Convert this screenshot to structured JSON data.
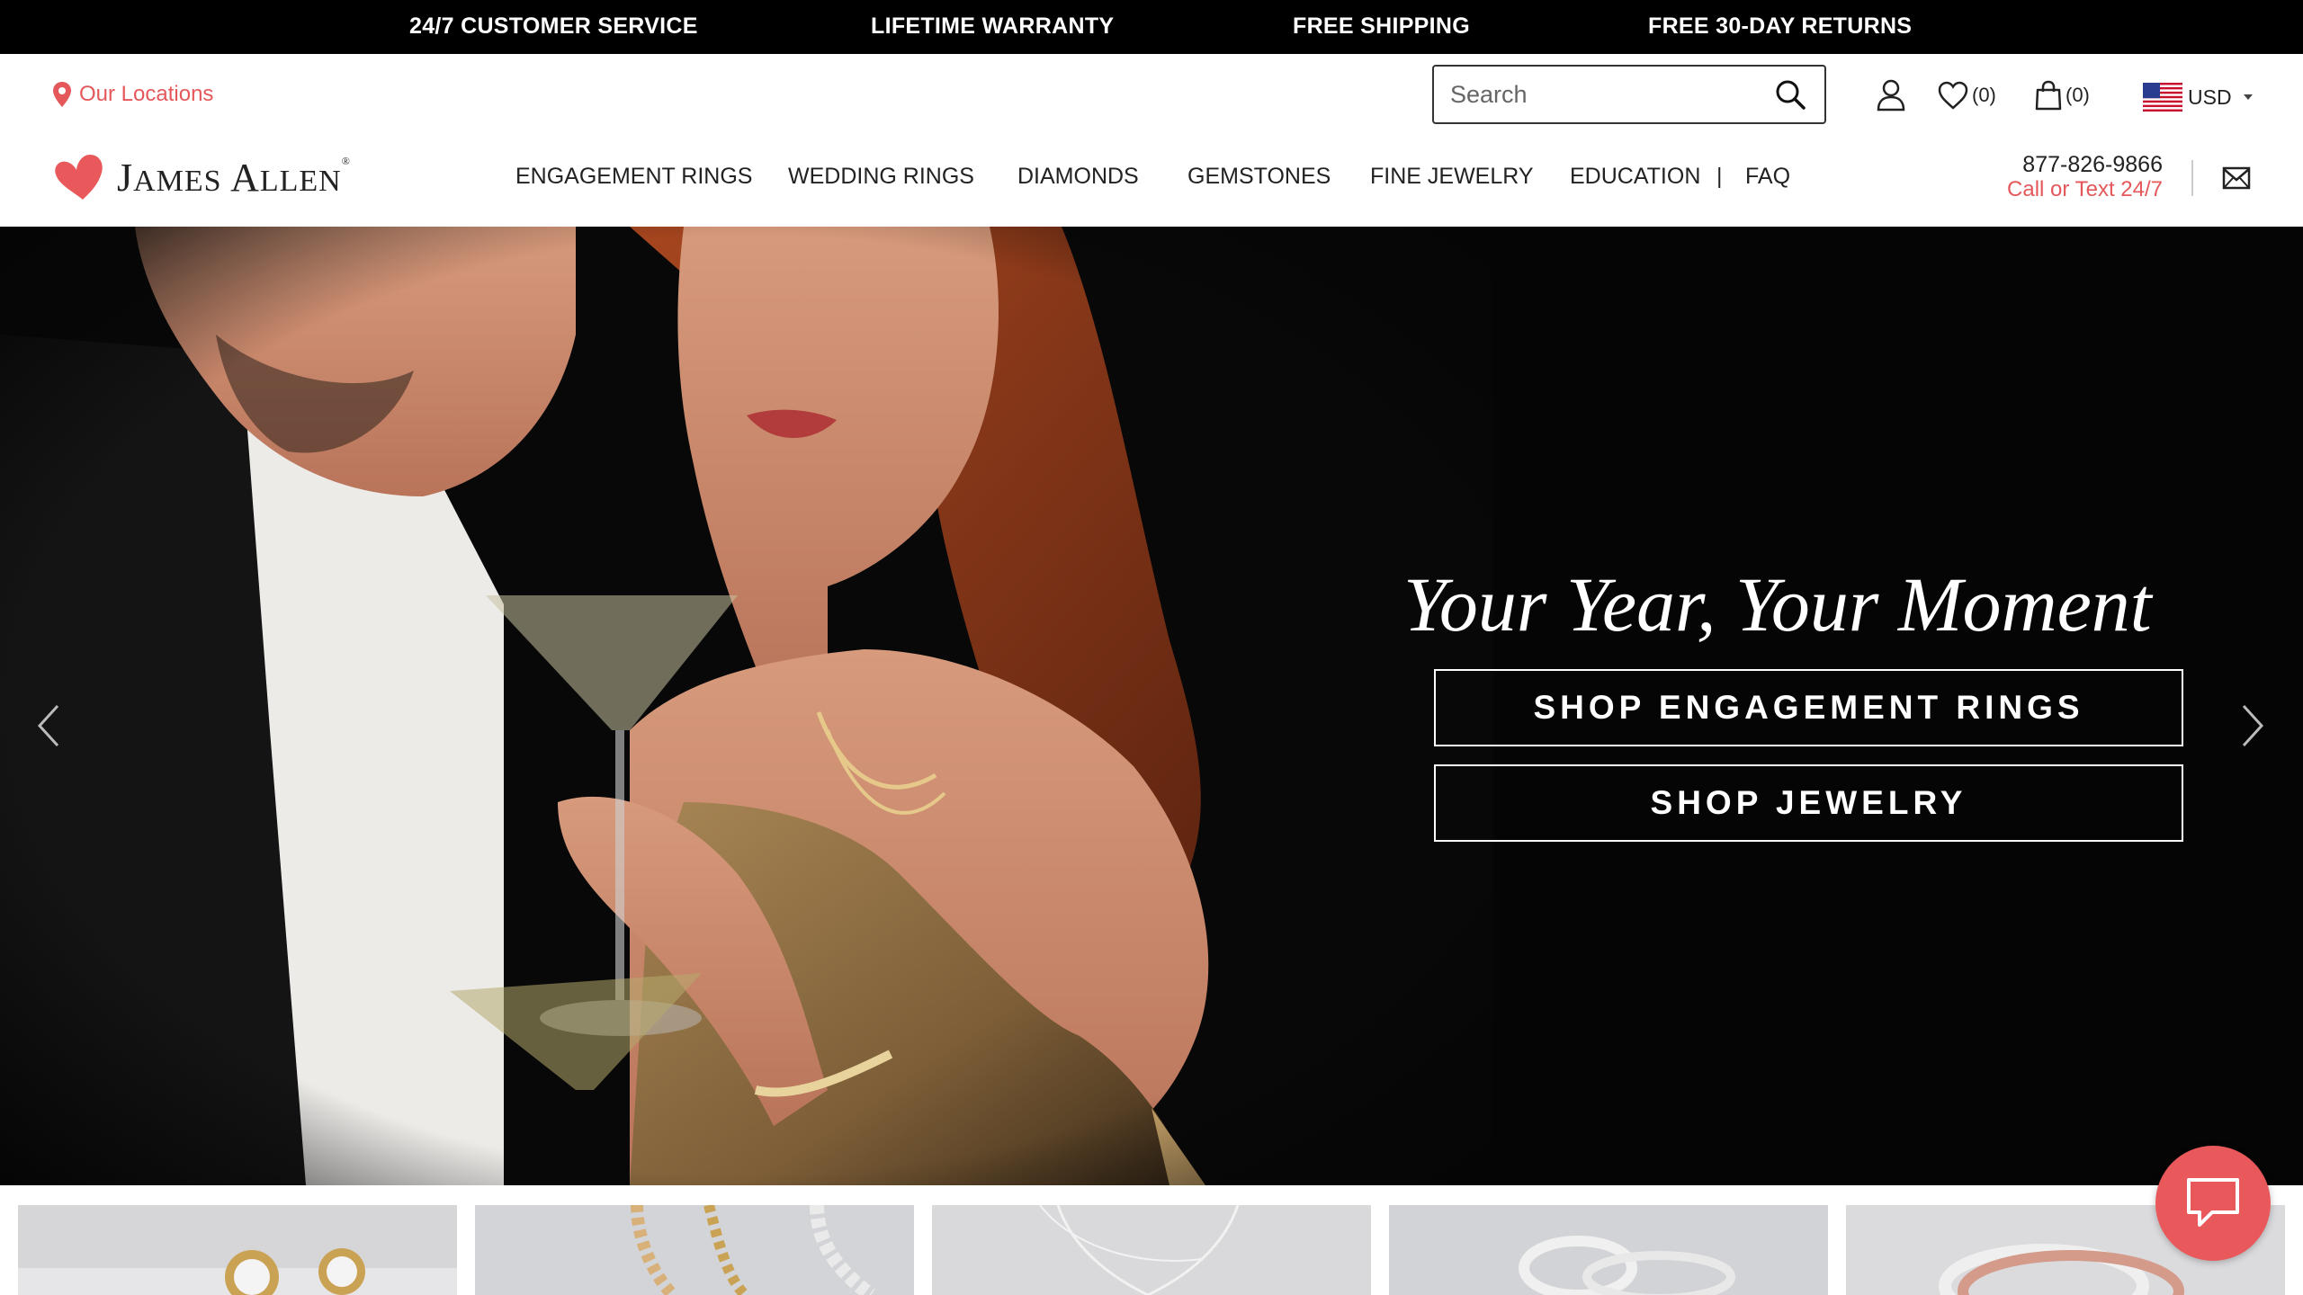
{
  "promo_bar": {
    "items": [
      "24/7 CUSTOMER SERVICE",
      "LIFETIME WARRANTY",
      "FREE SHIPPING",
      "FREE 30-DAY RETURNS"
    ]
  },
  "utility": {
    "locations_label": "Our Locations",
    "search_placeholder": "Search",
    "wishlist_count": "(0)",
    "cart_count": "(0)",
    "currency": "USD"
  },
  "header": {
    "logo_text_first": "J",
    "logo_text_rest_1": "AMES ",
    "logo_text_a": "A",
    "logo_text_rest_2": "LLEN",
    "logo_reg": "®",
    "nav": [
      "ENGAGEMENT RINGS",
      "WEDDING RINGS",
      "DIAMONDS",
      "GEMSTONES",
      "FINE JEWELRY",
      "EDUCATION",
      "FAQ"
    ],
    "nav_separator": "|",
    "phone_number": "877-826-9866",
    "phone_sub": "Call or Text 24/7"
  },
  "hero": {
    "title": "Your Year, Your Moment",
    "buttons": [
      "SHOP ENGAGEMENT RINGS",
      "SHOP JEWELRY"
    ]
  },
  "colors": {
    "accent": "#e4585b",
    "promo_bg": "#000000",
    "hero_bg": "#050505",
    "chat_bg": "#e9595c"
  },
  "icons": [
    "location-pin-icon",
    "search-icon",
    "user-icon",
    "heart-icon",
    "bag-icon",
    "us-flag-icon",
    "caret-down-icon",
    "mail-icon",
    "chevron-left-icon",
    "chevron-right-icon",
    "chat-icon"
  ]
}
